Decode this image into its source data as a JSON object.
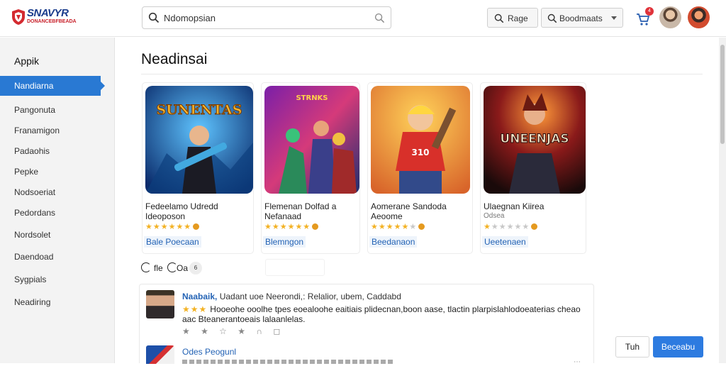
{
  "header": {
    "logo_text": "SNAVYR",
    "logo_sub": "DONANCEBFBEADA",
    "search_value": "Ndomopsian",
    "range_label": "Rage",
    "bookmarks_label": "Boodmaats",
    "cart_badge": "4"
  },
  "sidebar": {
    "title": "Appik",
    "items": [
      {
        "label": "Nandiarna"
      },
      {
        "label": "Pangonuta"
      },
      {
        "label": "Franamigon"
      },
      {
        "label": "Padaohis"
      },
      {
        "label": "Pepke"
      },
      {
        "label": "Nodsoeriat"
      },
      {
        "label": "Pedordans"
      },
      {
        "label": "Nordsolet"
      },
      {
        "label": "Daendoad"
      },
      {
        "label": "Sygpials"
      },
      {
        "label": "Neadiring"
      }
    ]
  },
  "main": {
    "title": "Neadinsai",
    "cards": [
      {
        "art_text": "SUNENTAS",
        "line1": "Fedeelamo Udredd",
        "line2": "Ideoposon",
        "stars": 5,
        "tag": "Bale Poecaan"
      },
      {
        "art_text": "STRNKS",
        "line1": "Flemenan Dolfad a",
        "line2": "Nefanaad",
        "stars": 5,
        "tag": "Blemngon"
      },
      {
        "art_text": "",
        "line1": "Aomerane Sandoda",
        "line2": "Aeoome",
        "stars": 4,
        "tag": "Beedanaon"
      },
      {
        "art_text": "UNEENJAS",
        "line1": "Ulaegnan Kiirea",
        "line2": "Odsea",
        "stars": 1,
        "tag": "Ueetenaen"
      }
    ],
    "filter_one": "fle",
    "filter_two": "Oa",
    "filter_chip": "6"
  },
  "reviews": [
    {
      "name": "Naabaik,",
      "meta": "Uadant uoe Neerondi,: Relalior, ubem, Caddabd",
      "text": "Hooeohe ooolhe tpes eoealoohe eaitiais plidecnan,boon aase, tlactin plarpislahlodoeaterias cheao aac Bteanerantoeais lalaanlelas.",
      "link": "lalaanlelas."
    },
    {
      "name": "Odes Peogunl"
    }
  ],
  "footer": {
    "cancel_label": "Tuh",
    "primary_label": "Beceabu"
  }
}
